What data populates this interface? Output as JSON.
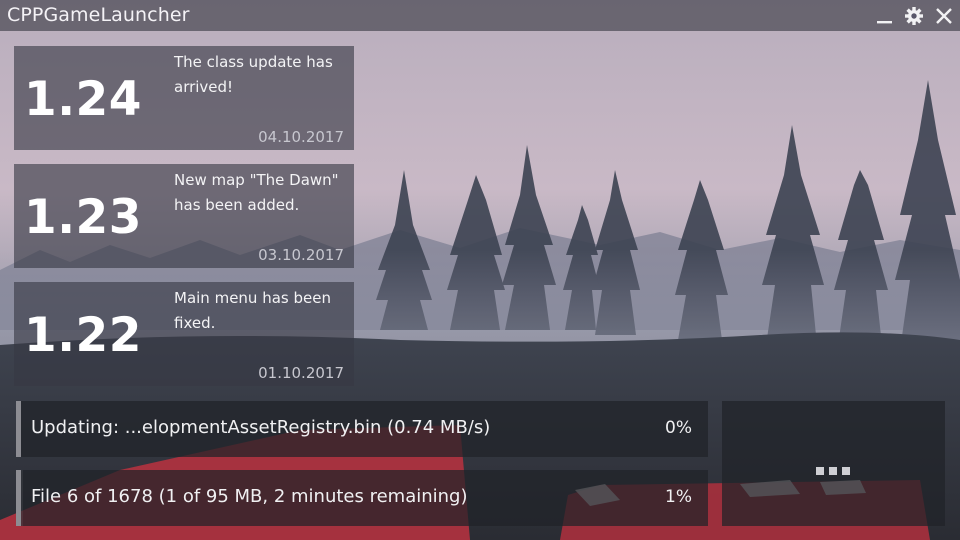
{
  "window": {
    "title": "CPPGameLauncher",
    "controls": [
      "minimize-icon",
      "gear-icon",
      "close-icon"
    ]
  },
  "news": [
    {
      "version": "1.24",
      "text": "The class update has arrived!",
      "date": "04.10.2017"
    },
    {
      "version": "1.23",
      "text": "New map \"The Dawn\" has been added.",
      "date": "03.10.2017"
    },
    {
      "version": "1.22",
      "text": "Main menu has been fixed.",
      "date": "01.10.2017"
    }
  ],
  "progress": {
    "current": {
      "label": "Updating: ...elopmentAssetRegistry.bin (0.74 MB/s)",
      "percent_text": "0%",
      "fraction": 0.0
    },
    "overall": {
      "label": "File 6 of 1678 (1 of 95 MB, 2 minutes remaining)",
      "percent_text": "1%",
      "fraction": 0.01
    }
  },
  "action": {
    "icon": "more-dots-icon"
  },
  "colors": {
    "titlebar": "#58566080",
    "card_bg": "#37384480",
    "progress_bg": "#202228b8",
    "accent": "#8d8d93",
    "text": "#ffffff"
  }
}
